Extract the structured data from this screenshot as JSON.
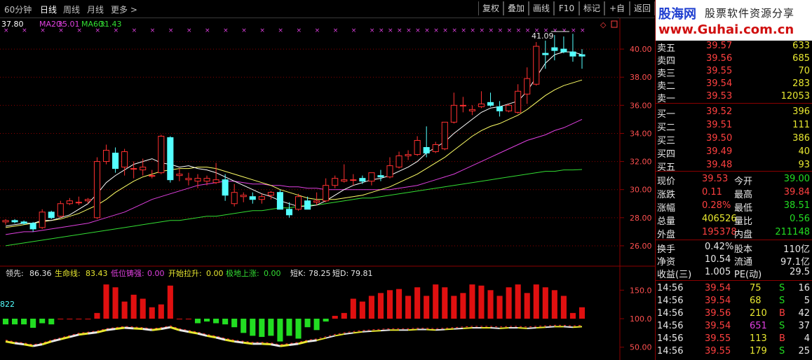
{
  "toolbar": {
    "periods": [
      "60分钟",
      "日线",
      "周线",
      "月线",
      "更多 >"
    ],
    "active_period": "日线",
    "buttons": [
      "复权",
      "叠加",
      "画线",
      "F10",
      "标记",
      "+自选",
      "返回"
    ]
  },
  "main_legend": {
    "ma5": "37.80",
    "ma20_label": "MA20:",
    "ma20": "35.01",
    "ma60_label": "MA60:",
    "ma60": "31.43"
  },
  "high_marker": "41.09",
  "price_axis": [
    "40.00",
    "38.00",
    "36.00",
    "34.00",
    "32.00",
    "30.00",
    "28.00",
    "26.00"
  ],
  "indicator_legend": {
    "lead_label": "领先:",
    "lead": "86.36",
    "life_label": "生命线:",
    "life": "83.43",
    "low_label": "低位铸强:",
    "low": "0.00",
    "start_label": "开始拉升:",
    "start": "0.00",
    "ground_label": "极地上涨:",
    "ground": "0.00",
    "k_label": "短K:",
    "k": "78.25",
    "d_label": "短D:",
    "d": "79.81"
  },
  "indicator_left_value": "822",
  "indicator_axis": [
    "150.0",
    "100.0",
    "50.00"
  ],
  "brand": {
    "name": "股海网",
    "slogan": "股票软件资源分享",
    "url": "www.Guhai.com.cn"
  },
  "asks": [
    {
      "label": "卖五",
      "price": "39.57",
      "vol": "633"
    },
    {
      "label": "卖四",
      "price": "39.56",
      "vol": "685"
    },
    {
      "label": "卖三",
      "price": "39.55",
      "vol": "70"
    },
    {
      "label": "卖二",
      "price": "39.54",
      "vol": "283"
    },
    {
      "label": "卖一",
      "price": "39.53",
      "vol": "12053"
    }
  ],
  "bids": [
    {
      "label": "买一",
      "price": "39.52",
      "vol": "396"
    },
    {
      "label": "买二",
      "price": "39.51",
      "vol": "111"
    },
    {
      "label": "买三",
      "price": "39.50",
      "vol": "386"
    },
    {
      "label": "买四",
      "price": "39.49",
      "vol": "40"
    },
    {
      "label": "买五",
      "price": "39.48",
      "vol": "93"
    }
  ],
  "quote": [
    {
      "l1": "现价",
      "v1": "39.53",
      "c1": "red",
      "l2": "今开",
      "v2": "39.00",
      "c2": "green"
    },
    {
      "l1": "涨跌",
      "v1": "0.11",
      "c1": "red",
      "l2": "最高",
      "v2": "39.84",
      "c2": "red"
    },
    {
      "l1": "涨幅",
      "v1": "0.28%",
      "c1": "red",
      "l2": "最低",
      "v2": "38.51",
      "c2": "green"
    },
    {
      "l1": "总量",
      "v1": "406526",
      "c1": "yellow",
      "l2": "量比",
      "v2": "0.56",
      "c2": "green"
    },
    {
      "l1": "外盘",
      "v1": "195378",
      "c1": "red",
      "l2": "内盘",
      "v2": "211148",
      "c2": "green"
    }
  ],
  "fundamentals": [
    {
      "l1": "换手",
      "v1": "0.42%",
      "l2": "股本",
      "v2": "110亿"
    },
    {
      "l1": "净资",
      "v1": "10.54",
      "l2": "流通",
      "v2": "97.1亿"
    },
    {
      "l1": "收益(三)",
      "v1": "1.005",
      "l2": "PE(动)",
      "v2": "29.5"
    }
  ],
  "ticks": [
    {
      "time": "14:56",
      "price": "39.54",
      "vol": "75",
      "vc": "yellow",
      "side": "S",
      "n": "16"
    },
    {
      "time": "14:56",
      "price": "39.54",
      "vol": "68",
      "vc": "yellow",
      "side": "S",
      "n": "5"
    },
    {
      "time": "14:56",
      "price": "39.56",
      "vol": "210",
      "vc": "yellow",
      "side": "B",
      "n": "42"
    },
    {
      "time": "14:56",
      "price": "39.54",
      "vol": "651",
      "vc": "magenta",
      "side": "S",
      "n": "37"
    },
    {
      "time": "14:56",
      "price": "39.55",
      "vol": "113",
      "vc": "yellow",
      "side": "B",
      "n": "4"
    },
    {
      "time": "14:56",
      "price": "39.55",
      "vol": "179",
      "vc": "yellow",
      "side": "S",
      "n": "25"
    }
  ],
  "colors": {
    "up": "#ff3030",
    "down": "#54ffff",
    "ma5": "#ffffff",
    "ma10": "#ffff66",
    "ma20": "#e040e0",
    "ma60": "#33dd33",
    "grid": "#8b0000"
  },
  "chart_data": {
    "type": "candlestick",
    "ylim": [
      25,
      41.5
    ],
    "candles": [
      [
        27.7,
        27.9,
        27.5,
        27.8
      ],
      [
        27.8,
        27.9,
        27.6,
        27.7
      ],
      [
        27.7,
        27.8,
        27.5,
        27.6
      ],
      [
        27.6,
        27.7,
        27.0,
        27.2
      ],
      [
        27.3,
        28.6,
        27.2,
        28.4
      ],
      [
        28.4,
        28.5,
        27.9,
        28.0
      ],
      [
        28.1,
        29.2,
        28.0,
        29.0
      ],
      [
        29.0,
        29.4,
        28.9,
        29.2
      ],
      [
        29.1,
        29.5,
        28.9,
        29.1
      ],
      [
        29.2,
        29.4,
        29.0,
        29.3
      ],
      [
        28.0,
        32.3,
        27.9,
        32.0
      ],
      [
        32.0,
        33.2,
        31.8,
        32.8
      ],
      [
        32.6,
        33.0,
        31.2,
        31.5
      ],
      [
        31.6,
        32.9,
        31.0,
        32.7
      ],
      [
        31.5,
        32.0,
        30.8,
        31.5
      ],
      [
        31.4,
        32.2,
        31.0,
        31.6
      ],
      [
        31.0,
        31.4,
        30.8,
        31.0
      ],
      [
        31.2,
        33.9,
        31.1,
        33.8
      ],
      [
        33.7,
        33.8,
        30.5,
        30.7
      ],
      [
        31.0,
        31.5,
        30.6,
        31.1
      ],
      [
        30.7,
        31.2,
        30.3,
        30.8
      ],
      [
        30.6,
        31.1,
        30.1,
        30.8
      ],
      [
        30.6,
        31.0,
        30.3,
        30.8
      ],
      [
        30.5,
        31.9,
        30.4,
        30.7
      ],
      [
        30.7,
        31.1,
        29.2,
        29.6
      ],
      [
        29.0,
        30.4,
        28.8,
        29.8
      ],
      [
        29.5,
        29.8,
        29.1,
        29.6
      ],
      [
        29.5,
        29.8,
        29.0,
        29.3
      ],
      [
        29.3,
        29.7,
        29.0,
        29.5
      ],
      [
        29.6,
        29.9,
        29.3,
        29.8
      ],
      [
        29.8,
        30.0,
        28.6,
        28.6
      ],
      [
        28.6,
        29.1,
        28.0,
        28.2
      ],
      [
        28.6,
        29.7,
        28.5,
        29.5
      ],
      [
        29.2,
        29.5,
        28.6,
        28.6
      ],
      [
        29.1,
        29.8,
        28.9,
        29.2
      ],
      [
        29.2,
        30.8,
        29.1,
        30.3
      ],
      [
        30.3,
        31.0,
        30.1,
        30.8
      ],
      [
        30.6,
        31.8,
        30.5,
        30.7
      ],
      [
        30.7,
        31.1,
        30.3,
        30.7
      ],
      [
        30.8,
        31.0,
        30.4,
        30.6
      ],
      [
        30.6,
        31.2,
        30.3,
        31.2
      ],
      [
        31.0,
        31.4,
        30.6,
        30.9
      ],
      [
        30.9,
        32.3,
        30.8,
        31.7
      ],
      [
        31.6,
        32.7,
        31.5,
        32.4
      ],
      [
        32.4,
        32.8,
        32.1,
        32.5
      ],
      [
        32.5,
        33.8,
        32.4,
        33.5
      ],
      [
        33.0,
        34.5,
        32.3,
        32.6
      ],
      [
        32.7,
        33.4,
        32.6,
        33.2
      ],
      [
        32.9,
        34.8,
        32.8,
        34.8
      ],
      [
        34.8,
        36.9,
        34.7,
        36.0
      ],
      [
        36.0,
        36.6,
        35.5,
        36.0
      ],
      [
        35.6,
        36.0,
        35.3,
        35.7
      ],
      [
        35.9,
        37.0,
        35.8,
        36.1
      ],
      [
        36.2,
        36.9,
        35.9,
        36.0
      ],
      [
        35.9,
        36.3,
        35.2,
        35.6
      ],
      [
        35.6,
        36.1,
        35.5,
        36.0
      ],
      [
        35.5,
        37.5,
        35.4,
        37.0
      ],
      [
        36.8,
        38.7,
        36.1,
        37.9
      ],
      [
        37.5,
        40.5,
        37.4,
        40.2
      ],
      [
        39.7,
        40.6,
        38.6,
        39.6
      ],
      [
        40.1,
        41.0,
        39.2,
        39.9
      ],
      [
        40.0,
        40.9,
        39.7,
        39.8
      ],
      [
        39.8,
        41.09,
        39.1,
        39.5
      ],
      [
        39.6,
        40.0,
        38.6,
        39.5
      ]
    ],
    "ma5": [
      27.4,
      27.5,
      27.6,
      27.6,
      27.8,
      27.8,
      28.0,
      28.2,
      28.6,
      29.0,
      29.7,
      30.5,
      31.0,
      31.4,
      31.8,
      32.0,
      32.2,
      31.9,
      31.8,
      31.6,
      31.7,
      31.5,
      31.4,
      31.2,
      30.9,
      30.6,
      30.3,
      30.0,
      29.7,
      29.5,
      29.2,
      29.0,
      28.8,
      28.8,
      28.9,
      29.2,
      29.6,
      30.0,
      30.3,
      30.5,
      30.7,
      30.8,
      31.0,
      31.3,
      31.6,
      32.0,
      32.6,
      33.0,
      33.4,
      34.0,
      34.5,
      35.0,
      35.5,
      35.8,
      35.9,
      36.1,
      36.3,
      37.0,
      38.0,
      39.0,
      39.6,
      39.8,
      39.8,
      39.6
    ],
    "ma10": [
      27.3,
      27.4,
      27.5,
      27.6,
      27.7,
      27.8,
      27.9,
      28.1,
      28.3,
      28.6,
      28.9,
      29.3,
      29.8,
      30.2,
      30.6,
      30.9,
      31.1,
      31.3,
      31.4,
      31.5,
      31.5,
      31.6,
      31.6,
      31.5,
      31.3,
      31.1,
      30.9,
      30.7,
      30.5,
      30.3,
      30.0,
      29.8,
      29.6,
      29.4,
      29.3,
      29.3,
      29.3,
      29.4,
      29.5,
      29.6,
      29.8,
      30.0,
      30.2,
      30.5,
      30.8,
      31.1,
      31.5,
      31.9,
      32.3,
      32.8,
      33.3,
      33.8,
      34.2,
      34.5,
      34.7,
      35.0,
      35.3,
      35.7,
      36.2,
      36.7,
      37.1,
      37.4,
      37.6,
      37.8
    ],
    "ma20": [
      26.8,
      26.9,
      27.0,
      27.0,
      27.1,
      27.2,
      27.3,
      27.4,
      27.5,
      27.6,
      27.8,
      28.0,
      28.2,
      28.4,
      28.7,
      29.0,
      29.3,
      29.5,
      29.7,
      29.9,
      30.1,
      30.3,
      30.4,
      30.5,
      30.6,
      30.6,
      30.5,
      30.4,
      30.4,
      30.3,
      30.3,
      30.2,
      30.2,
      30.1,
      30.1,
      30.0,
      30.0,
      30.0,
      30.0,
      30.0,
      30.0,
      30.0,
      30.0,
      30.1,
      30.2,
      30.3,
      30.5,
      30.7,
      30.9,
      31.1,
      31.4,
      31.7,
      32.0,
      32.3,
      32.6,
      32.9,
      33.2,
      33.5,
      33.7,
      33.9,
      34.2,
      34.4,
      34.7,
      35.0
    ],
    "ma60": [
      26.0,
      26.1,
      26.2,
      26.3,
      26.4,
      26.5,
      26.6,
      26.7,
      26.8,
      26.9,
      27.0,
      27.1,
      27.2,
      27.3,
      27.4,
      27.5,
      27.6,
      27.7,
      27.8,
      27.8,
      27.9,
      28.0,
      28.1,
      28.1,
      28.2,
      28.3,
      28.4,
      28.5,
      28.5,
      28.6,
      28.7,
      28.7,
      28.8,
      28.9,
      28.9,
      29.0,
      29.1,
      29.2,
      29.3,
      29.4,
      29.4,
      29.5,
      29.6,
      29.7,
      29.8,
      29.9,
      30.0,
      30.1,
      30.2,
      30.3,
      30.4,
      30.5,
      30.6,
      30.7,
      30.8,
      30.9,
      31.0,
      31.1,
      31.2,
      31.3,
      31.3,
      31.4,
      31.4,
      31.43
    ],
    "indicator": {
      "ylim": [
        30,
        170
      ],
      "bars": [
        90,
        90,
        90,
        84,
        92,
        90,
        100,
        100,
        100,
        100,
        110,
        160,
        155,
        130,
        142,
        135,
        120,
        125,
        158,
        100,
        100,
        92,
        95,
        92,
        90,
        85,
        75,
        70,
        68,
        70,
        60,
        70,
        65,
        85,
        80,
        95,
        105,
        110,
        135,
        130,
        140,
        145,
        150,
        152,
        140,
        155,
        140,
        160,
        155,
        140,
        145,
        160,
        158,
        150,
        140,
        155,
        160,
        145,
        160,
        155,
        150,
        140,
        110,
        120
      ],
      "lead": [
        60,
        57,
        55,
        52,
        55,
        60,
        64,
        68,
        72,
        74,
        76,
        80,
        82,
        84,
        83,
        82,
        80,
        82,
        85,
        80,
        77,
        74,
        70,
        67,
        63,
        60,
        58,
        56,
        56,
        55,
        52,
        54,
        56,
        60,
        62,
        66,
        70,
        73,
        75,
        77,
        78,
        79,
        80,
        80,
        80,
        81,
        81,
        80,
        81,
        82,
        83,
        84,
        84,
        84,
        83,
        84,
        84,
        83,
        84,
        85,
        86,
        86,
        85,
        86
      ]
    }
  }
}
